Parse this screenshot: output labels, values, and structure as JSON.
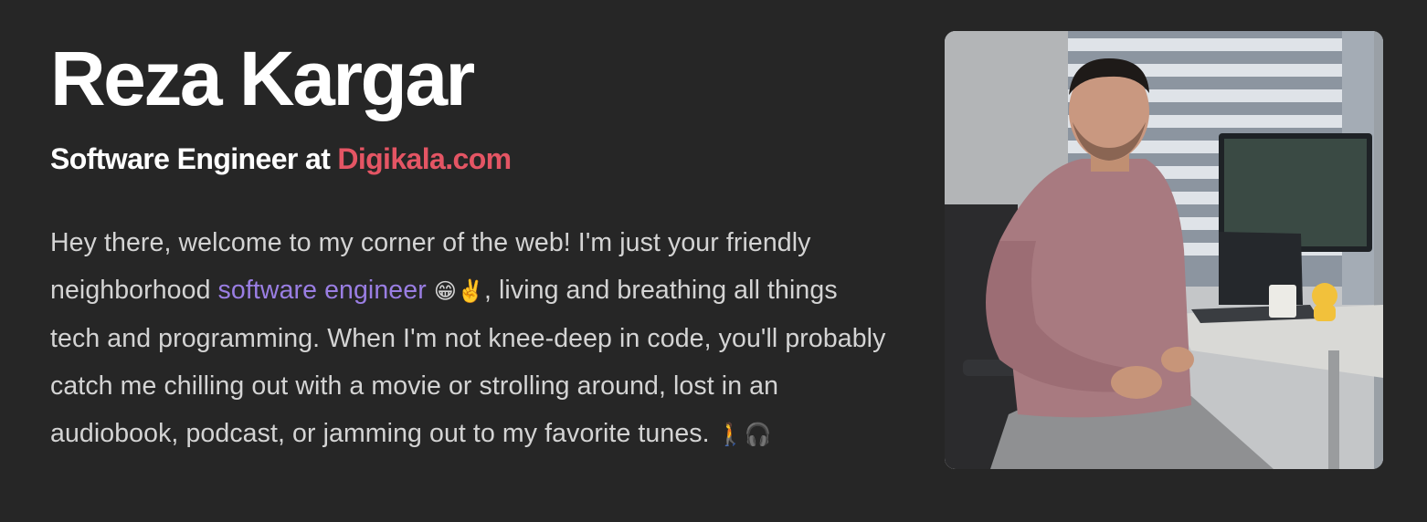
{
  "profile": {
    "name": "Reza Kargar",
    "role_prefix": "Software Engineer at",
    "company": "Digikala.com",
    "bio": {
      "part1": "Hey there, welcome to my corner of the web! I'm just your friendly neighborhood ",
      "link_text": "software engineer",
      "emoji_1": "😁✌️",
      "part2": ", living and breathing all things tech and programming. When I'm not knee-deep in code, you'll probably catch me chilling out with a movie or strolling around, lost in an audiobook, podcast, or jamming out to my favorite tunes. ",
      "emoji_2": "🚶🎧"
    },
    "photo": {
      "subject": "portrait-photo"
    }
  },
  "colors": {
    "background": "#262626",
    "heading": "#ffffff",
    "body_text": "#d4d4d4",
    "company_accent": "#e45564",
    "link_accent": "#9a7ee3"
  }
}
